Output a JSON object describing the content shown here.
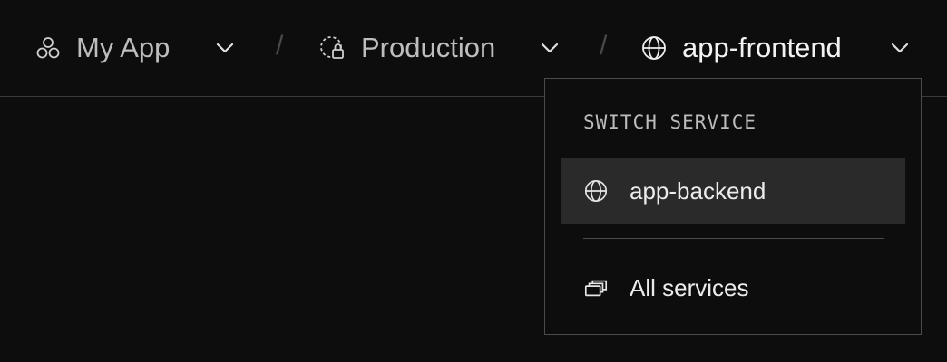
{
  "breadcrumb": {
    "project": {
      "label": "My App",
      "icon": "project-hexagons-icon"
    },
    "environment": {
      "label": "Production",
      "icon": "locked-environment-icon"
    },
    "service": {
      "label": "app-frontend",
      "icon": "globe-icon"
    },
    "separator": "/"
  },
  "dropdown": {
    "heading": "SWITCH SERVICE",
    "items": [
      {
        "label": "app-backend",
        "icon": "globe-icon",
        "highlighted": true
      }
    ],
    "all_services": {
      "label": "All services",
      "icon": "stacked-windows-icon"
    }
  }
}
